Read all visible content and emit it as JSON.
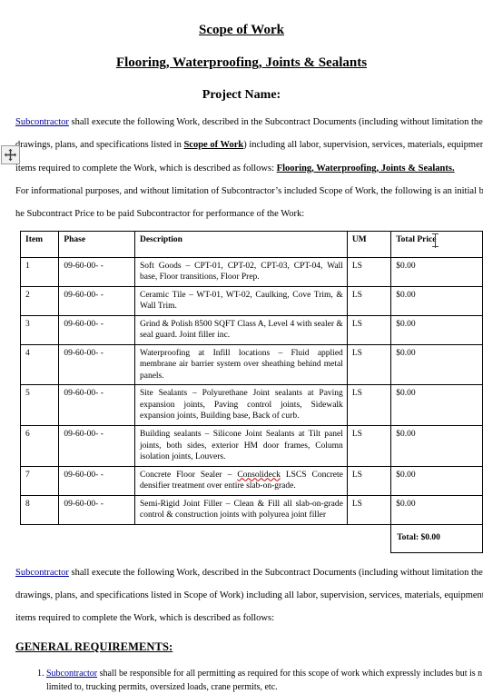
{
  "document": {
    "title": "Scope of Work",
    "subtitle": "Flooring, Waterproofing, Joints & Sealants",
    "project_label": "Project Name:"
  },
  "intro": {
    "line1_a": "Subcontractor",
    "line1_b": " shall execute the following Work, described in the Subcontract Documents (including without limitation the Pro",
    "line2_a": "drawings, plans, and specifications listed in ",
    "line2_b": "Scope of Work",
    "line2_c": ") including all labor, supervision, services, materials, equipment, and",
    "line3_a": "items required to complete the Work, which is described as follows: ",
    "line3_b": "Flooring, Waterproofing, Joints & Sealants.",
    "note_line1": "For informational purposes, and without limitation of Subcontractor’s included Scope of Work, the following is an initial breakdo",
    "note_line2": "he Subcontract Price to be paid Subcontractor for performance of the Work:"
  },
  "table": {
    "headers": {
      "item": "Item",
      "phase": "Phase",
      "description": "Description",
      "um": "UM",
      "total_price": "Total Price"
    },
    "rows": [
      {
        "item": "1",
        "phase": "09-60-00- -",
        "description": "Soft Goods – CPT-01, CPT-02, CPT-03, CPT-04, Wall base, Floor transitions, Floor Prep.",
        "um": "LS",
        "price": "$0.00"
      },
      {
        "item": "2",
        "phase": "09-60-00- -",
        "description": "Ceramic Tile – WT-01, WT-02, Caulking, Cove Trim, & Wall Trim.",
        "um": "LS",
        "price": "$0.00"
      },
      {
        "item": "3",
        "phase": "09-60-00- -",
        "description": "Grind & Polish 8500 SQFT Class A, Level 4 with sealer & seal guard. Joint filler inc.",
        "um": "LS",
        "price": "$0.00"
      },
      {
        "item": "4",
        "phase": "09-60-00- -",
        "description": "Waterproofing at Infill locations – Fluid applied membrane air barrier system over sheathing behind metal panels.",
        "um": "LS",
        "price": "$0.00"
      },
      {
        "item": "5",
        "phase": "09-60-00- -",
        "description": "Site Sealants – Polyurethane Joint sealants at Paving expansion joints, Paving control joints, Sidewalk expansion joints, Building base, Back of curb.",
        "um": "LS",
        "price": "$0.00"
      },
      {
        "item": "6",
        "phase": "09-60-00- -",
        "description": "Building sealants – Silicone Joint Sealants at Tilt panel joints, both sides, exterior HM door frames, Column isolation joints, Louvers.",
        "um": "LS",
        "price": "$0.00"
      },
      {
        "item": "7",
        "phase": "09-60-00- -",
        "description_pre": "Concrete Floor Sealer – ",
        "description_misspelled": "Consolideck",
        "description_post": " LSCS Concrete densifier treatment over entire slab-on-grade.",
        "um": "LS",
        "price": "$0.00"
      },
      {
        "item": "8",
        "phase": "09-60-00- -",
        "description": "Semi-Rigid Joint Filler – Clean & Fill all slab-on-grade control & construction joints with polyurea joint filler",
        "um": "LS",
        "price": "$0.00"
      }
    ],
    "total": "Total: $0.00"
  },
  "outro": {
    "line1_a": "Subcontractor",
    "line1_b": " shall execute the following Work, described in the Subcontract Documents (including without limitation the Pro",
    "line2": "drawings, plans, and specifications listed in Scope of Work) including all labor, supervision, services, materials, equipment, and",
    "line3": "items required to complete the Work, which is described as follows:"
  },
  "general_requirements": {
    "heading": "GENERAL REQUIREMENTS:",
    "items": [
      {
        "link": "Subcontractor",
        "text": " shall be responsible for all permitting as required for this scope of work which expressly includes but is n",
        "text_line2": "limited to, trucking permits, oversized loads, crane permits, etc."
      }
    ]
  },
  "colors": {
    "hyperlink": "#0000a0",
    "spellcheck": "#d00000",
    "border": "#000000"
  },
  "icons": {
    "table_move_handle": "move-cross-icon"
  }
}
